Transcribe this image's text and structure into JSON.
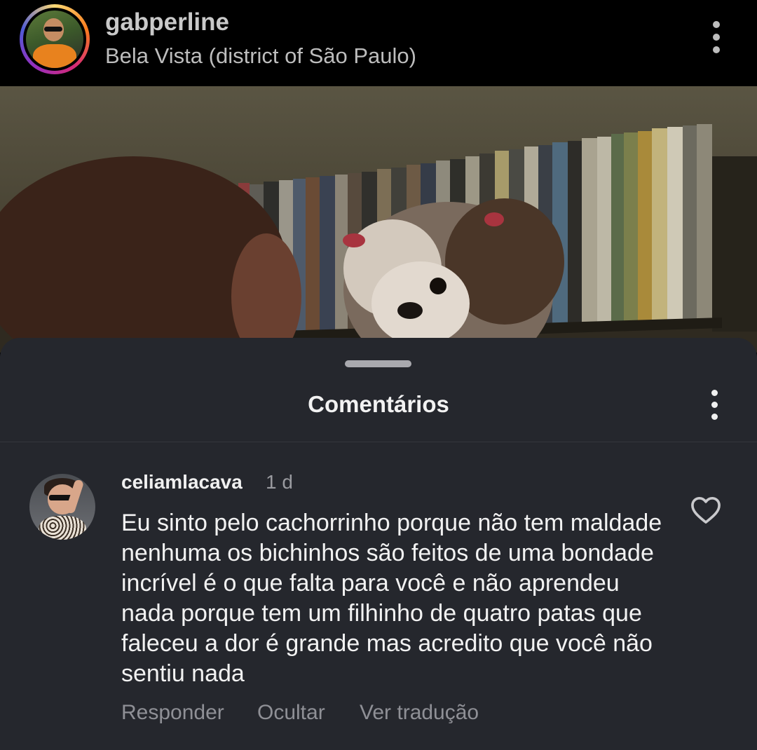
{
  "post": {
    "username": "gabperline",
    "location": "Bela Vista (district of São Paulo)"
  },
  "icons": {
    "header_more": "more-vertical-icon",
    "sheet_more": "more-vertical-icon",
    "like": "heart-outline-icon"
  },
  "comments_sheet": {
    "title": "Comentários",
    "comments": [
      {
        "username": "celiamlacava",
        "time": "1 d",
        "text": "Eu sinto pelo cachorrinho porque não tem maldade nenhuma os bichinhos são feitos de uma bondade incrível é o que falta para você e não aprendeu nada porque tem um filhinho de quatro patas que faleceu a dor é grande mas acredito que você não sentiu nada",
        "actions": {
          "reply": "Responder",
          "hide": "Ocultar",
          "translate": "Ver tradução"
        }
      }
    ]
  },
  "colors": {
    "sheet_background": "#25272d",
    "header_background": "#000000",
    "muted_text": "#8f9096"
  }
}
